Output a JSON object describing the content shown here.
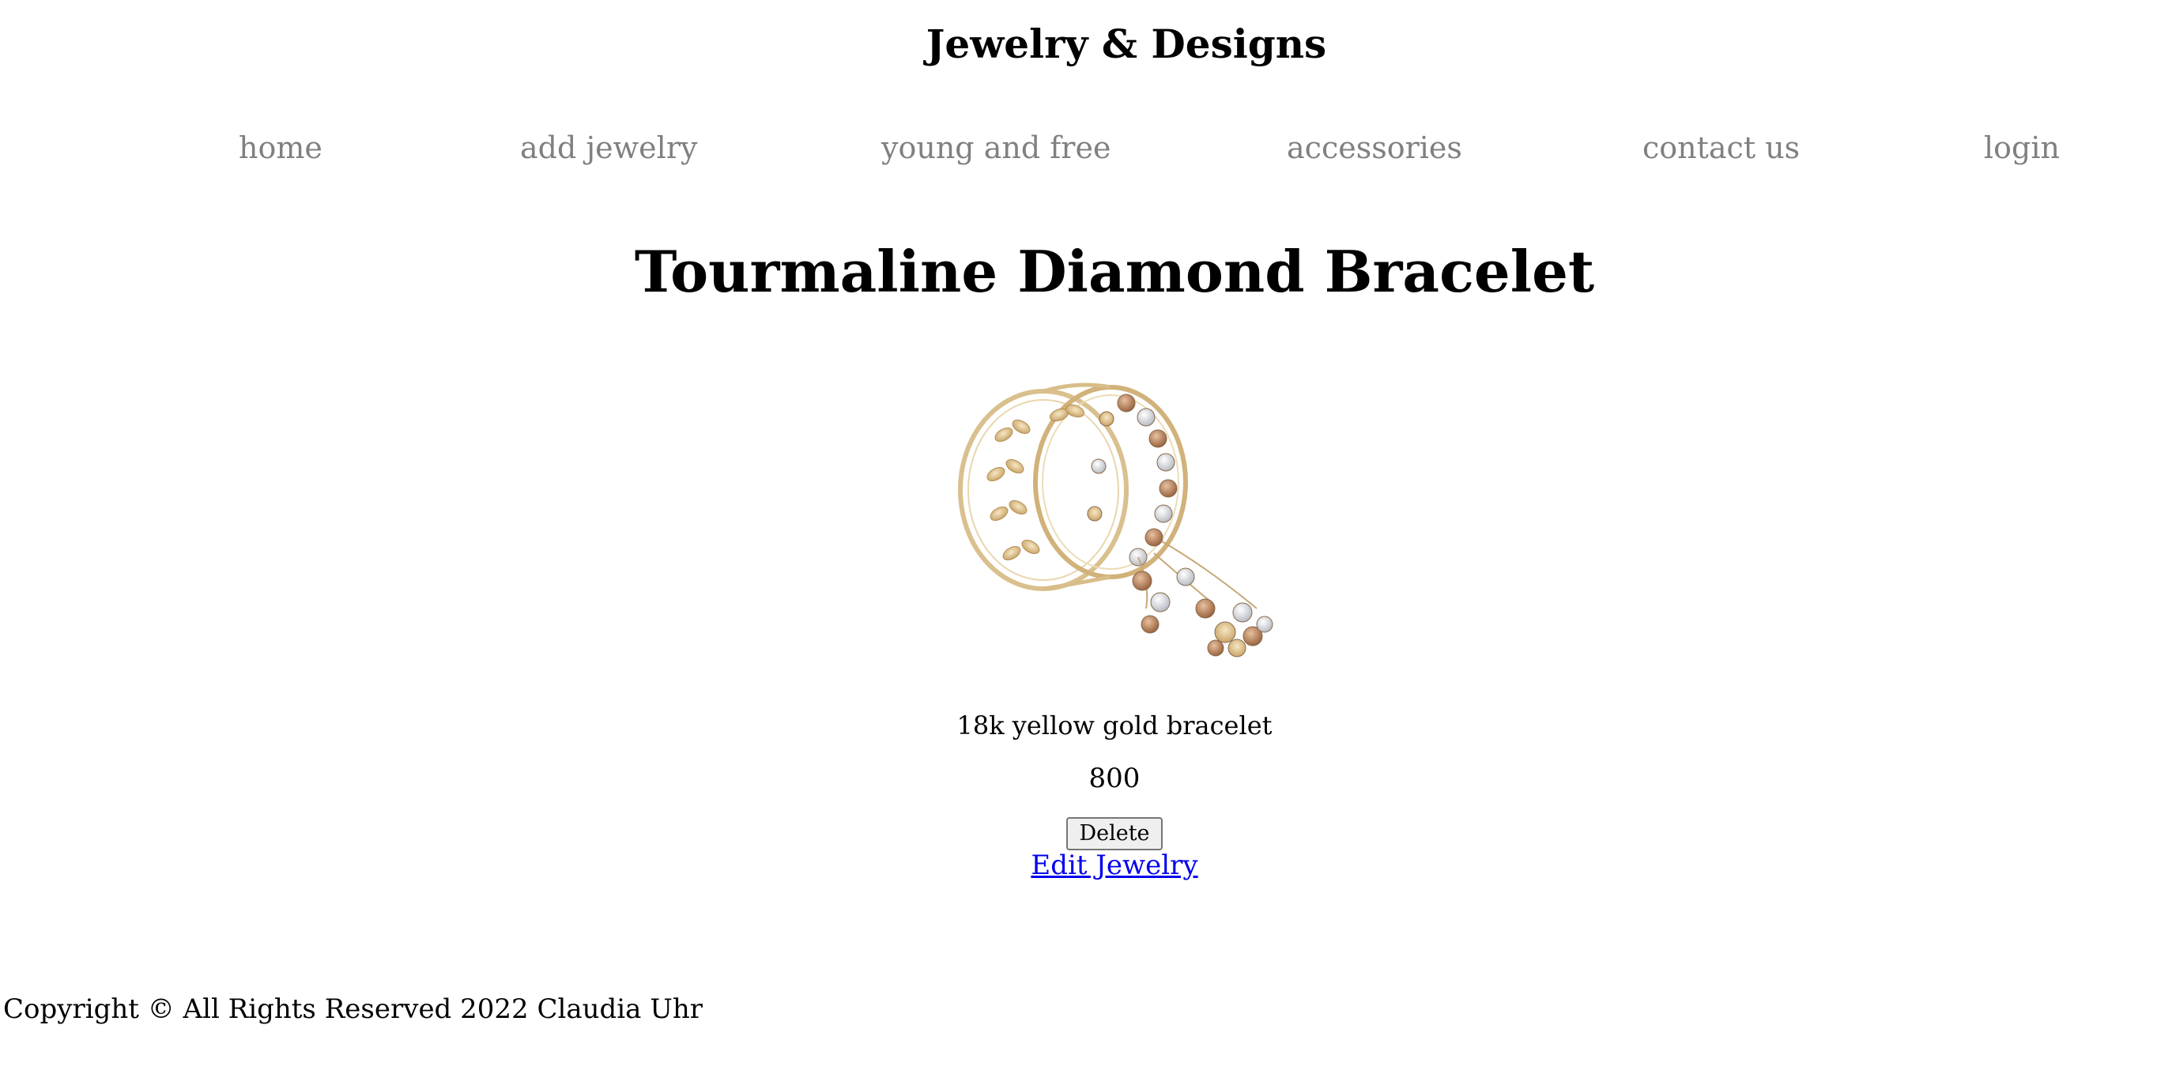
{
  "site": {
    "title": "Jewelry & Designs"
  },
  "nav": {
    "items": [
      {
        "label": "home"
      },
      {
        "label": "add jewelry"
      },
      {
        "label": "young and free"
      },
      {
        "label": "accessories"
      },
      {
        "label": "contact us"
      },
      {
        "label": "login"
      }
    ],
    "link_color": "#808080"
  },
  "product": {
    "name": "Tourmaline Diamond Bracelet",
    "description": "18k yellow gold bracelet",
    "price": "800",
    "image_icon": "bracelet-image"
  },
  "actions": {
    "delete_label": "Delete",
    "edit_label": "Edit Jewelry",
    "link_color": "#0000ee"
  },
  "footer": {
    "copyright": "Copyright © All Rights Reserved 2022 Claudia Uhr"
  }
}
